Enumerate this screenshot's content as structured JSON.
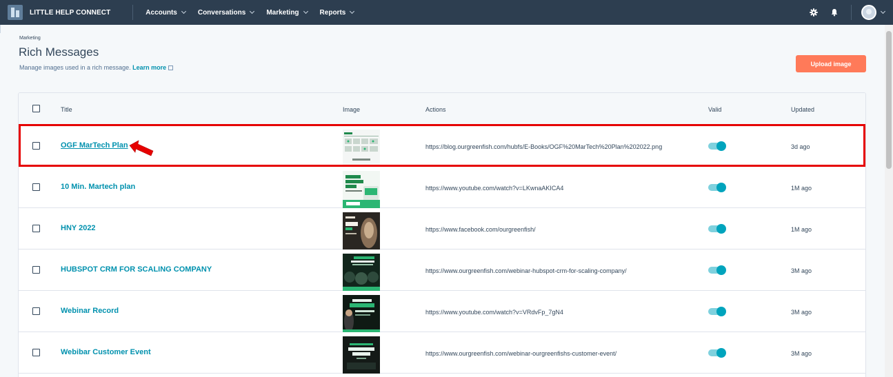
{
  "nav": {
    "brand": "LITTLE HELP CONNECT",
    "items": [
      "Accounts",
      "Conversations",
      "Marketing",
      "Reports"
    ]
  },
  "header": {
    "breadcrumb": "Marketing",
    "title": "Rich Messages",
    "subtitle": "Manage images used in a rich message.",
    "learn_more": "Learn more",
    "upload_label": "Upload image"
  },
  "table": {
    "columns": {
      "title": "Title",
      "image": "Image",
      "actions": "Actions",
      "valid": "Valid",
      "updated": "Updated"
    },
    "rows": [
      {
        "title": "OGF MarTech Plan",
        "action": "https://blog.ourgreenfish.com/hubfs/E-Books/OGF%20MarTech%20Plan%202022.png",
        "valid": true,
        "updated": "3d ago"
      },
      {
        "title": "10 Min. Martech plan",
        "action": "https://www.youtube.com/watch?v=LKwnaAKICA4",
        "valid": true,
        "updated": "1M ago"
      },
      {
        "title": "HNY 2022",
        "action": "https://www.facebook.com/ourgreenfish/",
        "valid": true,
        "updated": "1M ago"
      },
      {
        "title": "HUBSPOT CRM FOR SCALING COMPANY",
        "action": "https://www.ourgreenfish.com/webinar-hubspot-crm-for-scaling-company/",
        "valid": true,
        "updated": "3M ago"
      },
      {
        "title": "Webinar Record",
        "action": "https://www.youtube.com/watch?v=VRdvFp_7gN4",
        "valid": true,
        "updated": "3M ago"
      },
      {
        "title": "Webibar Customer Event",
        "action": "https://www.ourgreenfish.com/webinar-ourgreenfishs-customer-event/",
        "valid": true,
        "updated": "3M ago"
      }
    ]
  },
  "colors": {
    "nav_bg": "#2d3e50",
    "accent": "#ff7a59",
    "link": "#0091ae",
    "toggle": "#00a4bd",
    "highlight": "#e60000"
  }
}
